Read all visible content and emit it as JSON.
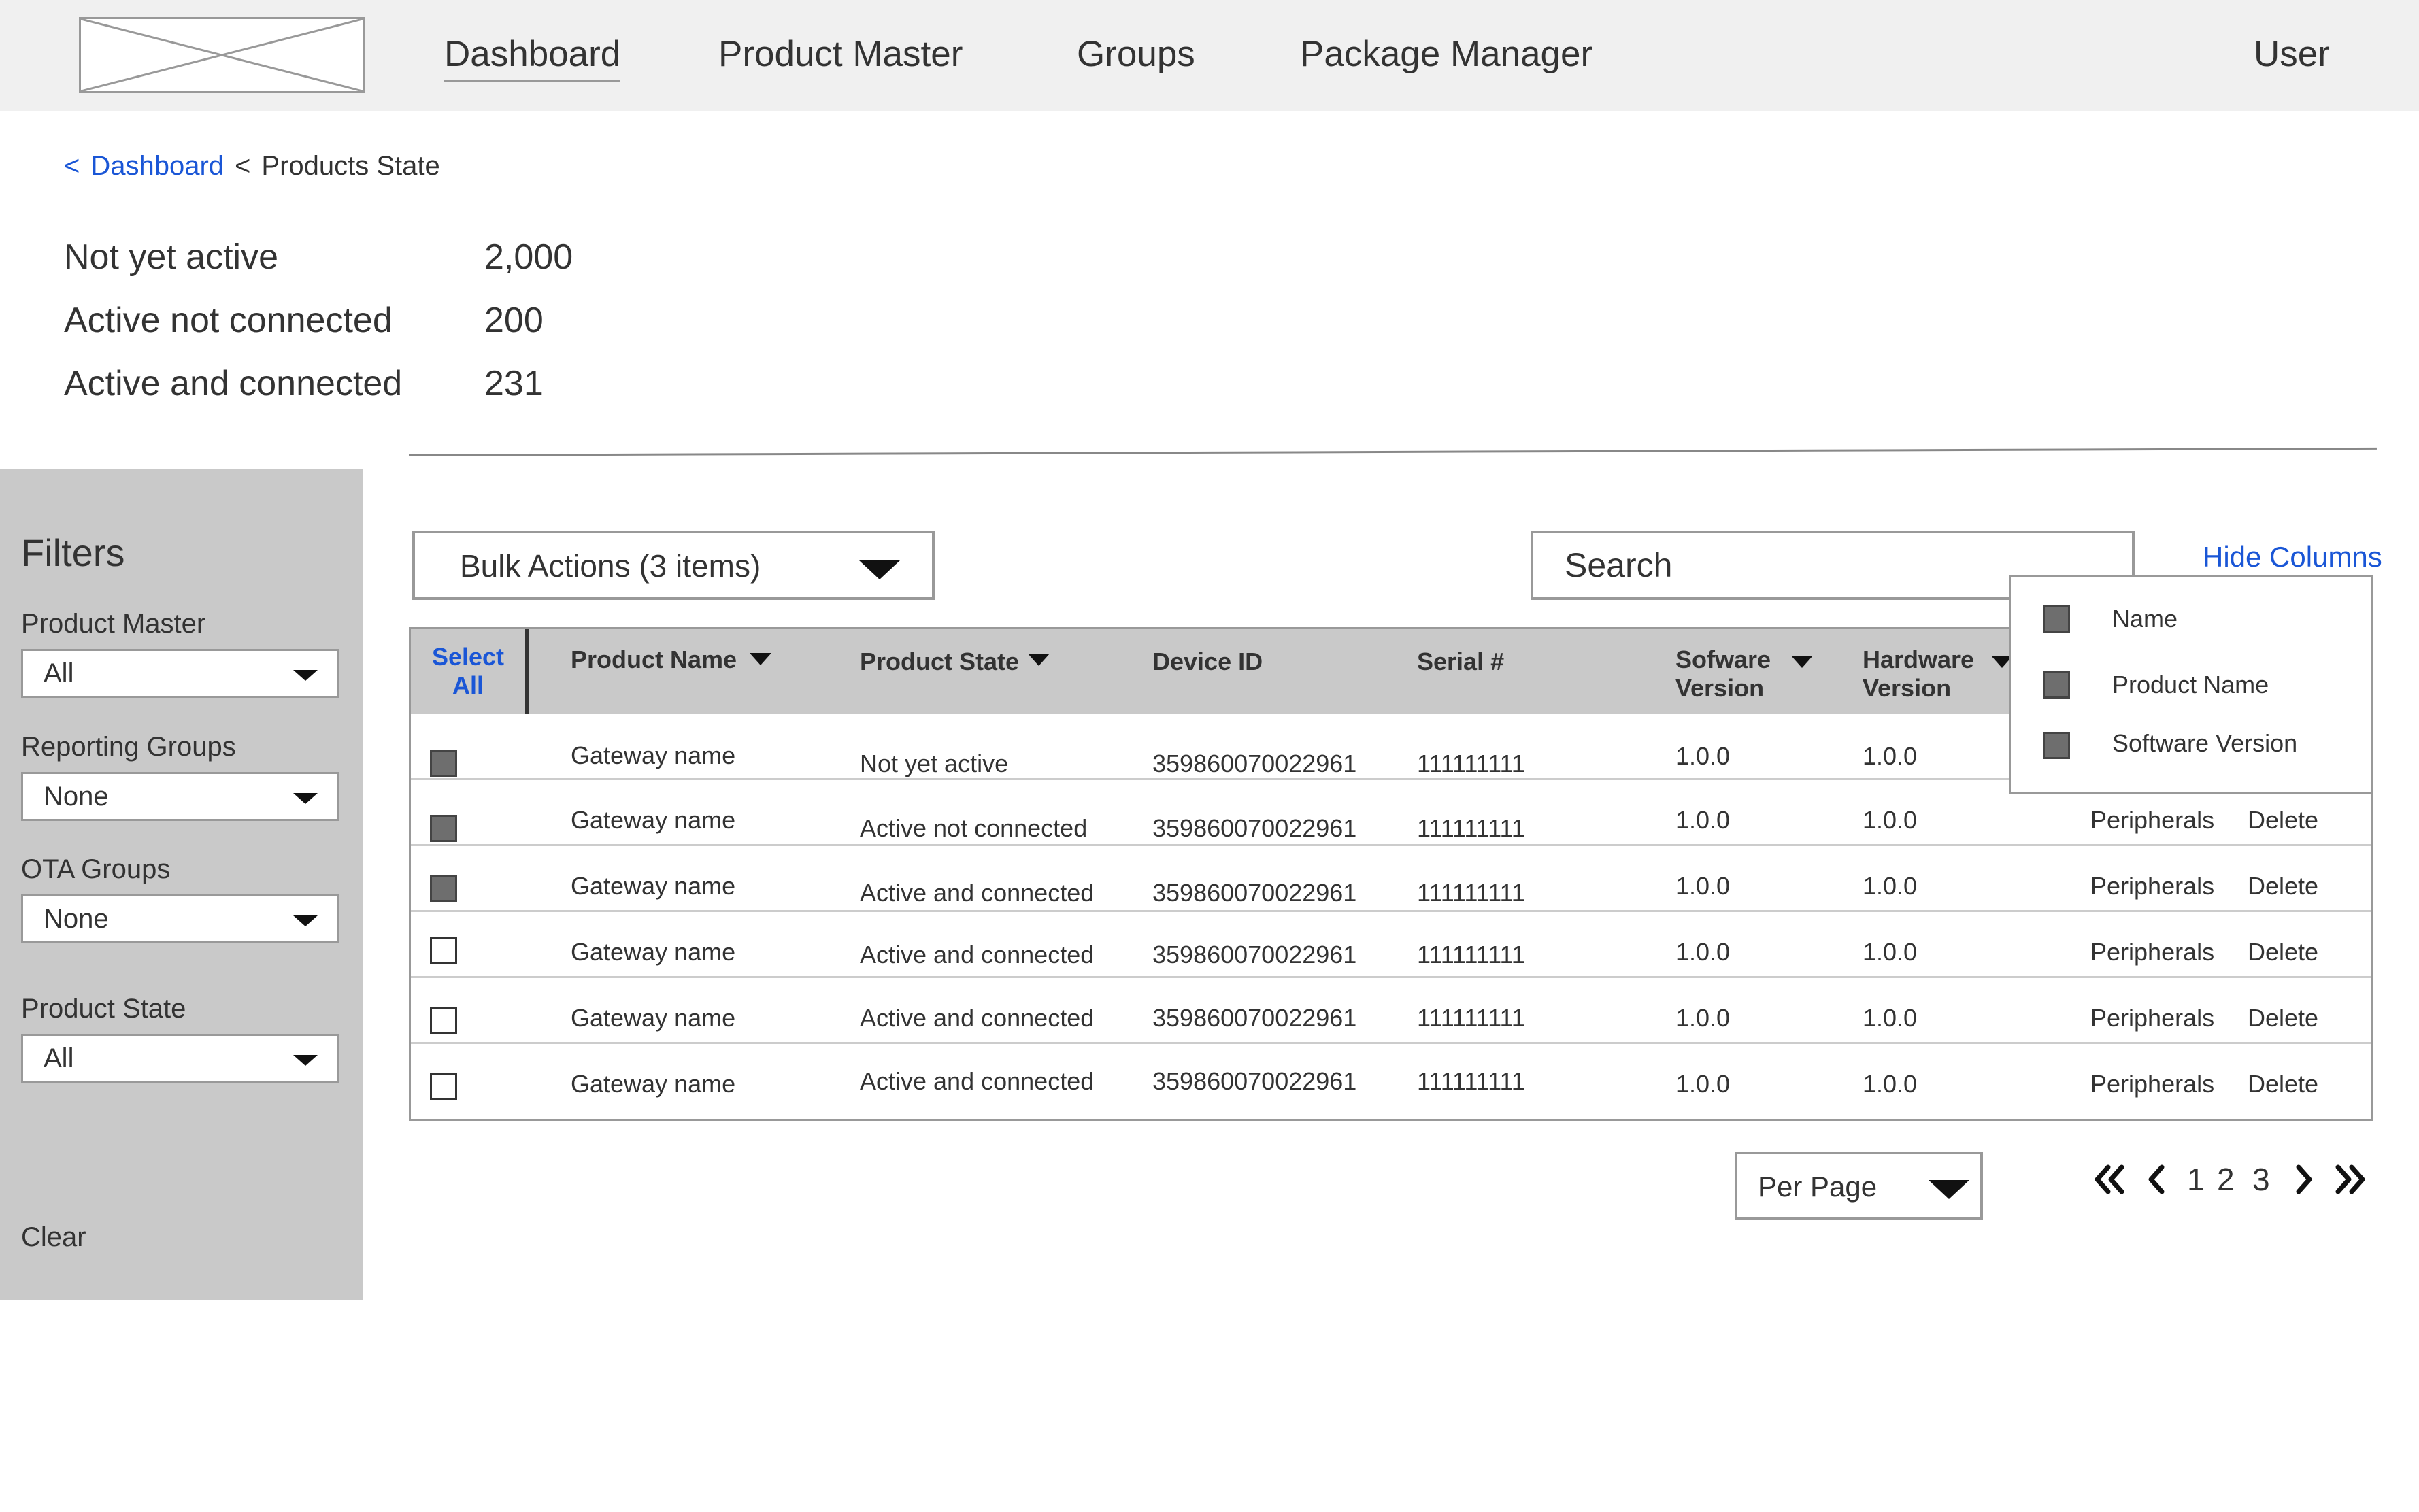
{
  "nav": {
    "items": [
      "Dashboard",
      "Product Master",
      "Groups",
      "Package Manager"
    ],
    "user": "User"
  },
  "breadcrumb": {
    "sep1": "<",
    "parent": "Dashboard",
    "sep2": "<",
    "current": "Products State"
  },
  "stats": [
    {
      "label": "Not yet active",
      "value": "2,000"
    },
    {
      "label": "Active not connected",
      "value": "200"
    },
    {
      "label": "Active and connected",
      "value": "231"
    }
  ],
  "filters": {
    "title": "Filters",
    "groups": [
      {
        "label": "Product Master",
        "value": "All"
      },
      {
        "label": "Reporting Groups",
        "value": "None"
      },
      {
        "label": "OTA Groups",
        "value": "None"
      },
      {
        "label": "Product State",
        "value": "All"
      }
    ],
    "clear": "Clear"
  },
  "toolbar": {
    "bulk_actions": "Bulk Actions (3 items)",
    "search_placeholder": "Search",
    "hide_columns": "Hide Columns"
  },
  "table": {
    "select_all": [
      "Select",
      "All"
    ],
    "headers": {
      "product_name": "Product Name",
      "product_state": "Product State",
      "device_id": "Device ID",
      "serial": "Serial #",
      "software": [
        "Sofware",
        "Version"
      ],
      "hardware": [
        "Hardware",
        "Version"
      ]
    },
    "rows": [
      {
        "checked": true,
        "name": "Gateway name",
        "state": "Not yet active",
        "device_id": "359860070022961",
        "serial": "111111111",
        "software": "1.0.0",
        "hardware": "1.0.0",
        "peripherals": "",
        "delete": ""
      },
      {
        "checked": true,
        "name": "Gateway name",
        "state": "Active not connected",
        "device_id": "359860070022961",
        "serial": "111111111",
        "software": "1.0.0",
        "hardware": "1.0.0",
        "peripherals": "Peripherals",
        "delete": "Delete"
      },
      {
        "checked": true,
        "name": "Gateway name",
        "state": "Active and connected",
        "device_id": "359860070022961",
        "serial": "111111111",
        "software": "1.0.0",
        "hardware": "1.0.0",
        "peripherals": "Peripherals",
        "delete": "Delete"
      },
      {
        "checked": false,
        "name": "Gateway name",
        "state": "Active and connected",
        "device_id": "359860070022961",
        "serial": "111111111",
        "software": "1.0.0",
        "hardware": "1.0.0",
        "peripherals": "Peripherals",
        "delete": "Delete"
      },
      {
        "checked": false,
        "name": "Gateway name",
        "state": "Active and connected",
        "device_id": "359860070022961",
        "serial": "111111111",
        "software": "1.0.0",
        "hardware": "1.0.0",
        "peripherals": "Peripherals",
        "delete": "Delete"
      },
      {
        "checked": false,
        "name": "Gateway name",
        "state": "Active and connected",
        "device_id": "359860070022961",
        "serial": "111111111",
        "software": "1.0.0",
        "hardware": "1.0.0",
        "peripherals": "Peripherals",
        "delete": "Delete"
      }
    ]
  },
  "column_menu": {
    "items": [
      {
        "label": "Name",
        "checked": true
      },
      {
        "label": "Product Name",
        "checked": true
      },
      {
        "label": "Software Version",
        "checked": true
      }
    ]
  },
  "pagination": {
    "per_page": "Per Page",
    "pages": [
      "1",
      "2",
      "3"
    ],
    "icons": [
      "first-page-icon",
      "prev-page-icon",
      "next-page-icon",
      "last-page-icon"
    ]
  },
  "colors": {
    "link": "#1a56d6",
    "nav_bg": "#f0f0f0",
    "panel_bg": "#c9c9c9",
    "checked": "#6e6e6e"
  }
}
